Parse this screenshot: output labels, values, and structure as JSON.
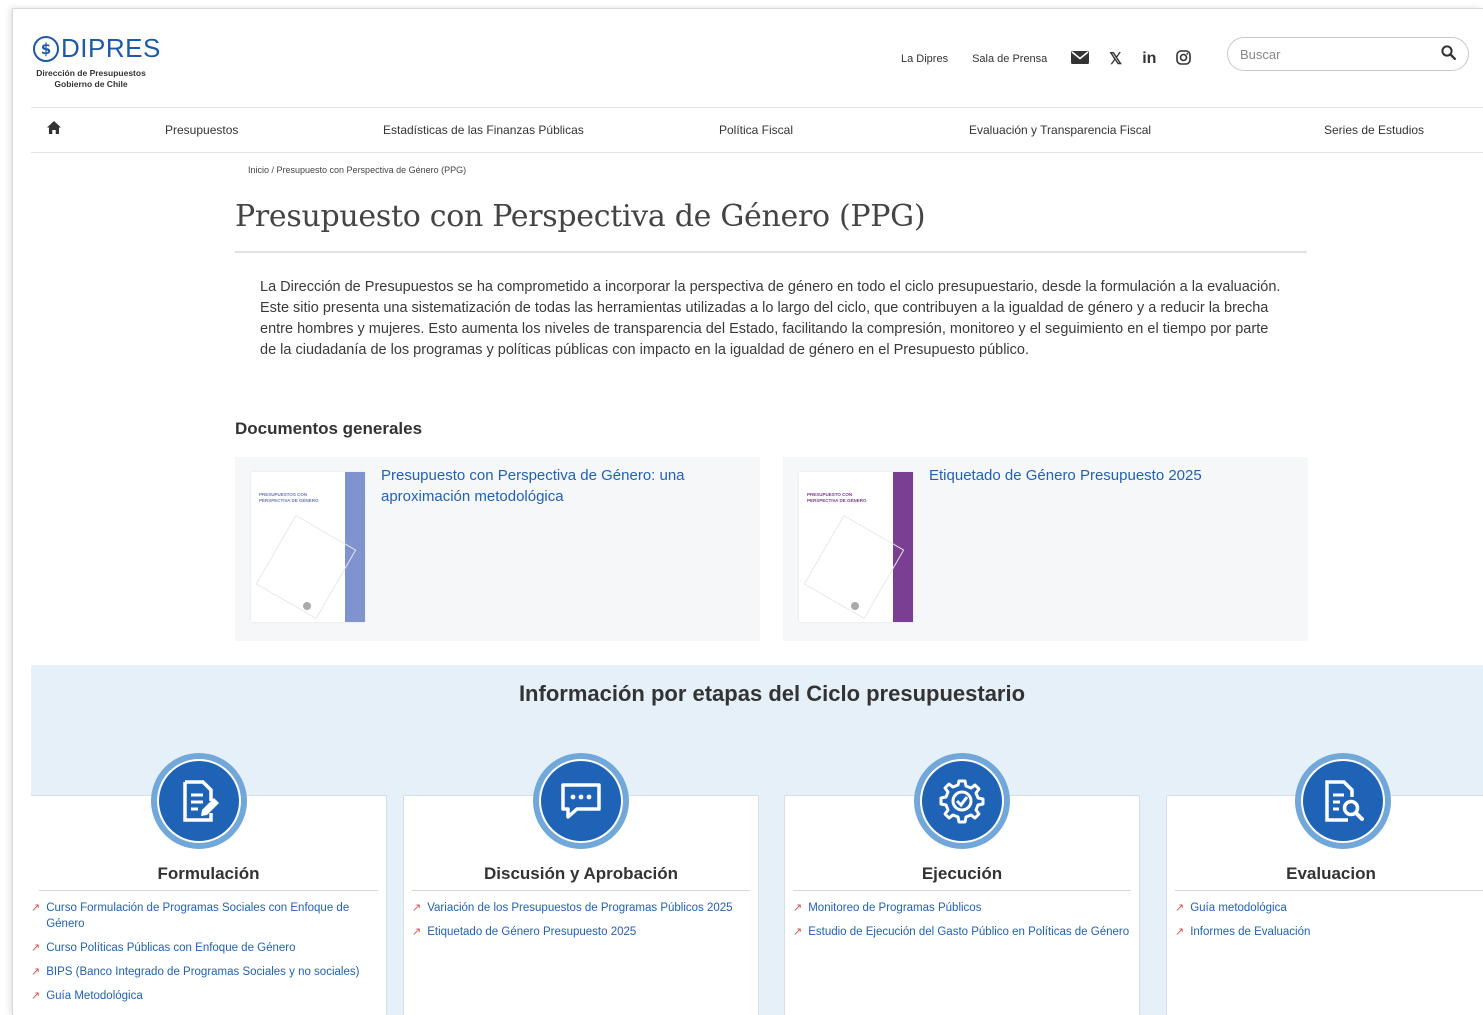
{
  "logo": {
    "brand": "DIPRES",
    "mark": "$",
    "sub1": "Dirección de Presupuestos",
    "sub2": "Gobierno de Chile"
  },
  "top_links": {
    "la_dipres": "La Dipres",
    "sala_prensa": "Sala de Prensa"
  },
  "social": {
    "x": "𝕏",
    "linkedin": "in",
    "instagram": "◎",
    "mail": "✉"
  },
  "search": {
    "placeholder": "Buscar",
    "icon": "⚲"
  },
  "nav": {
    "home_icon": "home-icon",
    "items": [
      "Presupuestos",
      "Estadísticas de las Finanzas Públicas",
      "Política Fiscal",
      "Evaluación y Transparencia Fiscal",
      "Series de Estudios"
    ]
  },
  "breadcrumb": "Inicio / Presupuesto con Perspectiva de Género (PPG)",
  "page_title": "Presupuesto con Perspectiva de Género (PPG)",
  "intro": "La Dirección de Presupuestos se ha comprometido a incorporar la perspectiva de género en todo el ciclo presupuestario, desde la formulación a la evaluación. Este sitio presenta una sistematización de todas las herramientas utilizadas a lo largo del ciclo, que contribuyen a la igualdad de género y a reducir la brecha entre hombres y mujeres. Esto aumenta los niveles de transparencia del Estado, facilitando la compresión, monitoreo y el seguimiento en el tiempo por parte de la ciudadanía de los programas y políticas públicas con impacto en la igualdad de género en el Presupuesto público.",
  "docs": {
    "heading": "Documentos generales",
    "items": [
      {
        "title": "Presupuesto con Perspectiva de Género: una aproximación metodológica",
        "cover_title": "PRESUPUESTOS CON PERSPECTIVA DE GÉNERO",
        "band_color": "#7f93cf"
      },
      {
        "title": "Etiquetado de Género Presupuesto 2025",
        "cover_title": "PRESUPUESTO CON PERSPECTIVA DE GÉNERO",
        "band_color": "#7a3e93"
      }
    ]
  },
  "stages": {
    "title": "Información por etapas del Ciclo presupuestario",
    "items": [
      {
        "name": "Formulación",
        "icon": "document-edit-icon",
        "links": [
          "Curso Formulación de Programas Sociales con Enfoque de Género",
          "Curso Políticas Públicas con Enfoque de Género",
          "BIPS (Banco Integrado de Programas Sociales y no sociales)",
          "Guía Metodológica"
        ]
      },
      {
        "name": "Discusión y Aprobación",
        "icon": "chat-icon",
        "links": [
          "Variación de los Presupuestos de Programas Públicos 2025",
          "Etiquetado de Género Presupuesto 2025"
        ]
      },
      {
        "name": "Ejecución",
        "icon": "gear-check-icon",
        "links": [
          "Monitoreo de Programas Públicos",
          "Estudio de Ejecución del Gasto Público en Políticas de Género"
        ]
      },
      {
        "name": "Evaluacion",
        "icon": "document-search-icon",
        "links": [
          "Guía metodológica",
          "Informes de Evaluación"
        ]
      }
    ]
  },
  "colors": {
    "brand": "#1e5aa8",
    "link": "#2162b3",
    "ext_icon": "#d9534f",
    "stage_bg": "#e6f0f9"
  }
}
